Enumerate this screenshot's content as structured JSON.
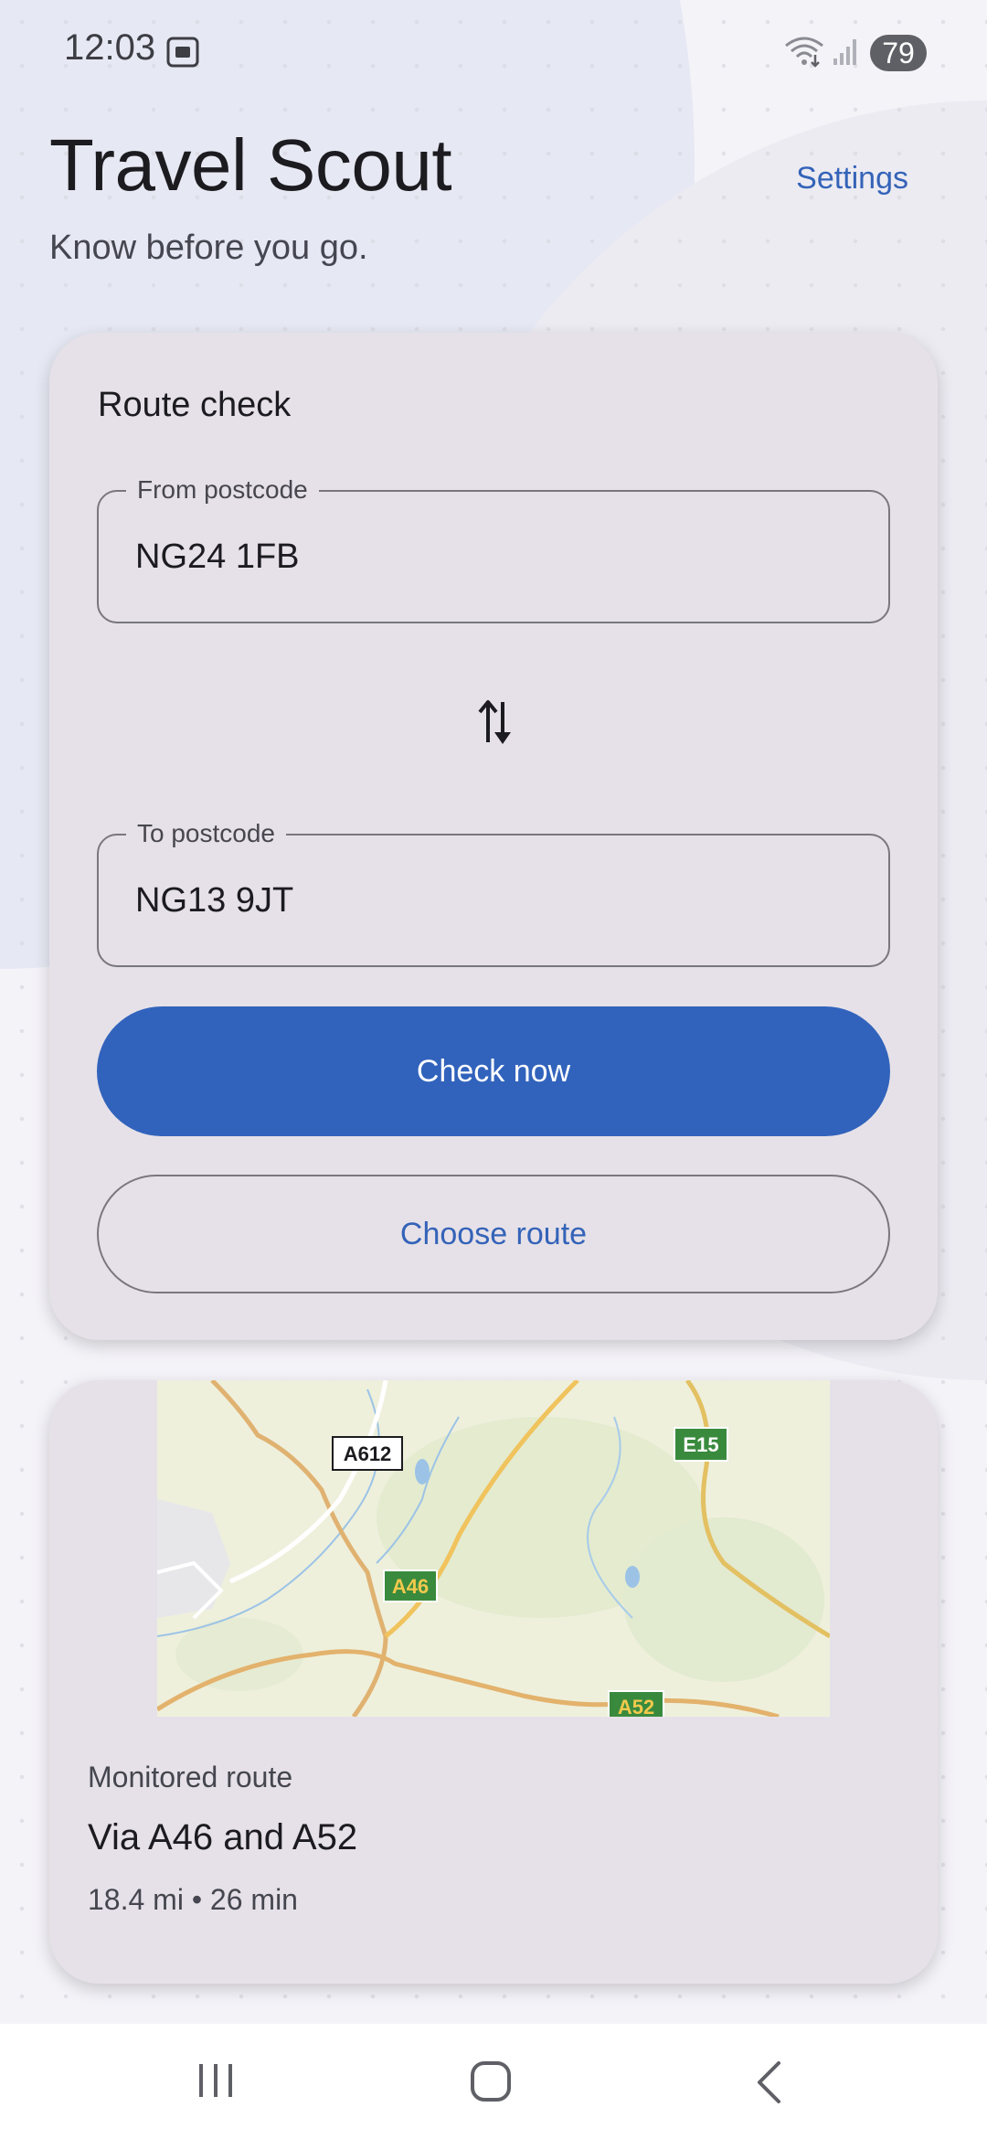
{
  "status_bar": {
    "time": "12:03",
    "battery": "79",
    "icons": [
      "screenshot-icon",
      "wifi-icon",
      "signal-icon"
    ]
  },
  "header": {
    "title": "Travel Scout",
    "tagline": "Know before you go.",
    "settings_label": "Settings"
  },
  "route_check": {
    "title": "Route check",
    "from_label": "From postcode",
    "from_value": "NG24 1FB",
    "to_label": "To postcode",
    "to_value": "NG13 9JT",
    "swap_icon": "swap-vertical-icon",
    "check_button": "Check now",
    "choose_button": "Choose route"
  },
  "monitored": {
    "map_labels": [
      "A612",
      "E15",
      "A46",
      "A52"
    ],
    "label": "Monitored route",
    "route_name": "Via A46 and A52",
    "meta": "18.4 mi • 26 min"
  },
  "nav_bar": {
    "icons": [
      "recents-icon",
      "home-icon",
      "back-icon"
    ]
  },
  "colors": {
    "accent": "#3163bc",
    "card": "#e6e1e8",
    "text_primary": "#1c1b1f",
    "text_secondary": "#45464f",
    "road_green": "#3a8a3e",
    "road_yellow": "#f2c94c"
  }
}
